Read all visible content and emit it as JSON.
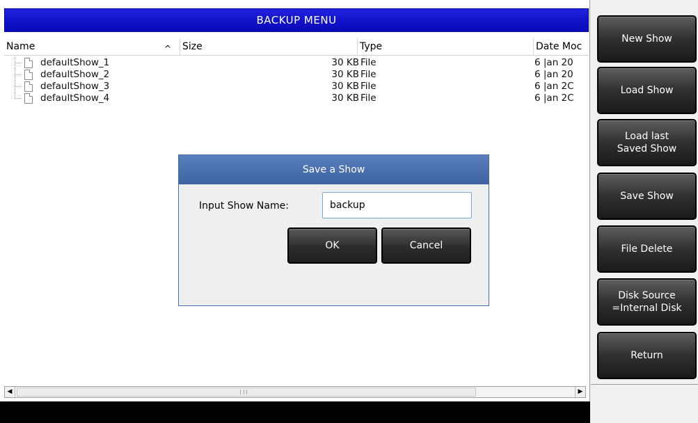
{
  "title": "BACKUP MENU",
  "columns": [
    {
      "label": "Name"
    },
    {
      "label": "Size"
    },
    {
      "label": "Type"
    },
    {
      "label": "Date Moc"
    }
  ],
  "files": [
    {
      "name": "defaultShow_1",
      "size": "30 KB",
      "type": "File",
      "date": "6 |an 20"
    },
    {
      "name": "defaultShow_2",
      "size": "30 KB",
      "type": "File",
      "date": "6 |an 20"
    },
    {
      "name": "defaultShow_3",
      "size": "30 KB",
      "type": "File",
      "date": "6 |an 2C"
    },
    {
      "name": "defaultShow_4",
      "size": "30 KB",
      "type": "File",
      "date": "6 |an 2C"
    }
  ],
  "dialog": {
    "title": "Save a Show",
    "label": "Input Show Name:",
    "input_value": "backup",
    "ok": "OK",
    "cancel": "Cancel"
  },
  "side_buttons": [
    {
      "label": "New Show"
    },
    {
      "label": "Load Show"
    },
    {
      "label": "Load last\nSaved Show"
    },
    {
      "label": "Save Show"
    },
    {
      "label": "File Delete"
    },
    {
      "label": "Disk Source\n=Internal Disk"
    },
    {
      "label": "Return"
    }
  ],
  "icons": {
    "sort": "sort-ascending-icon",
    "file": "file-icon",
    "scroll_left": "scroll-left-arrow-icon",
    "scroll_right": "scroll-right-arrow-icon"
  },
  "colors": {
    "title_bar": "#1414cc",
    "dialog_title": "#4a6fae",
    "button": "#2c2c2c",
    "status_bar": "#000000"
  }
}
